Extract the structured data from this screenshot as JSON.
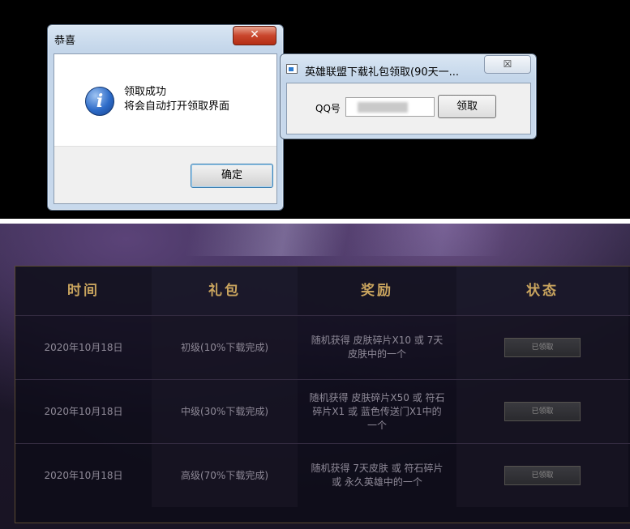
{
  "dialog_congrats": {
    "title": "恭喜",
    "close_glyph": "✕",
    "icon": "info-icon",
    "message_line1": "领取成功",
    "message_line2": "将会自动打开领取界面",
    "ok_label": "确定"
  },
  "qq_window": {
    "title": "英雄联盟下载礼包领取(90天一...",
    "close_glyph": "☒",
    "qq_label": "QQ号",
    "qq_value": "",
    "get_label": "领取"
  },
  "reward_table": {
    "headers": [
      "时间",
      "礼包",
      "奖励",
      "状态"
    ],
    "rows": [
      {
        "time": "2020年10月18日",
        "pack": "初级(10%下载完成)",
        "reward": "随机获得 皮肤碎片X10 或 7天皮肤中的一个",
        "status": "已领取"
      },
      {
        "time": "2020年10月18日",
        "pack": "中级(30%下载完成)",
        "reward": "随机获得 皮肤碎片X50 或 符石碎片X1 或 蓝色传送门X1中的一个",
        "status": "已领取"
      },
      {
        "time": "2020年10月18日",
        "pack": "高级(70%下载完成)",
        "reward": "随机获得 7天皮肤 或 符石碎片 或 永久英雄中的一个",
        "status": "已领取"
      }
    ]
  },
  "colors": {
    "header_gold": "#c9a45e",
    "table_bg": "#0e0c18",
    "close_red": "#c9452c"
  }
}
